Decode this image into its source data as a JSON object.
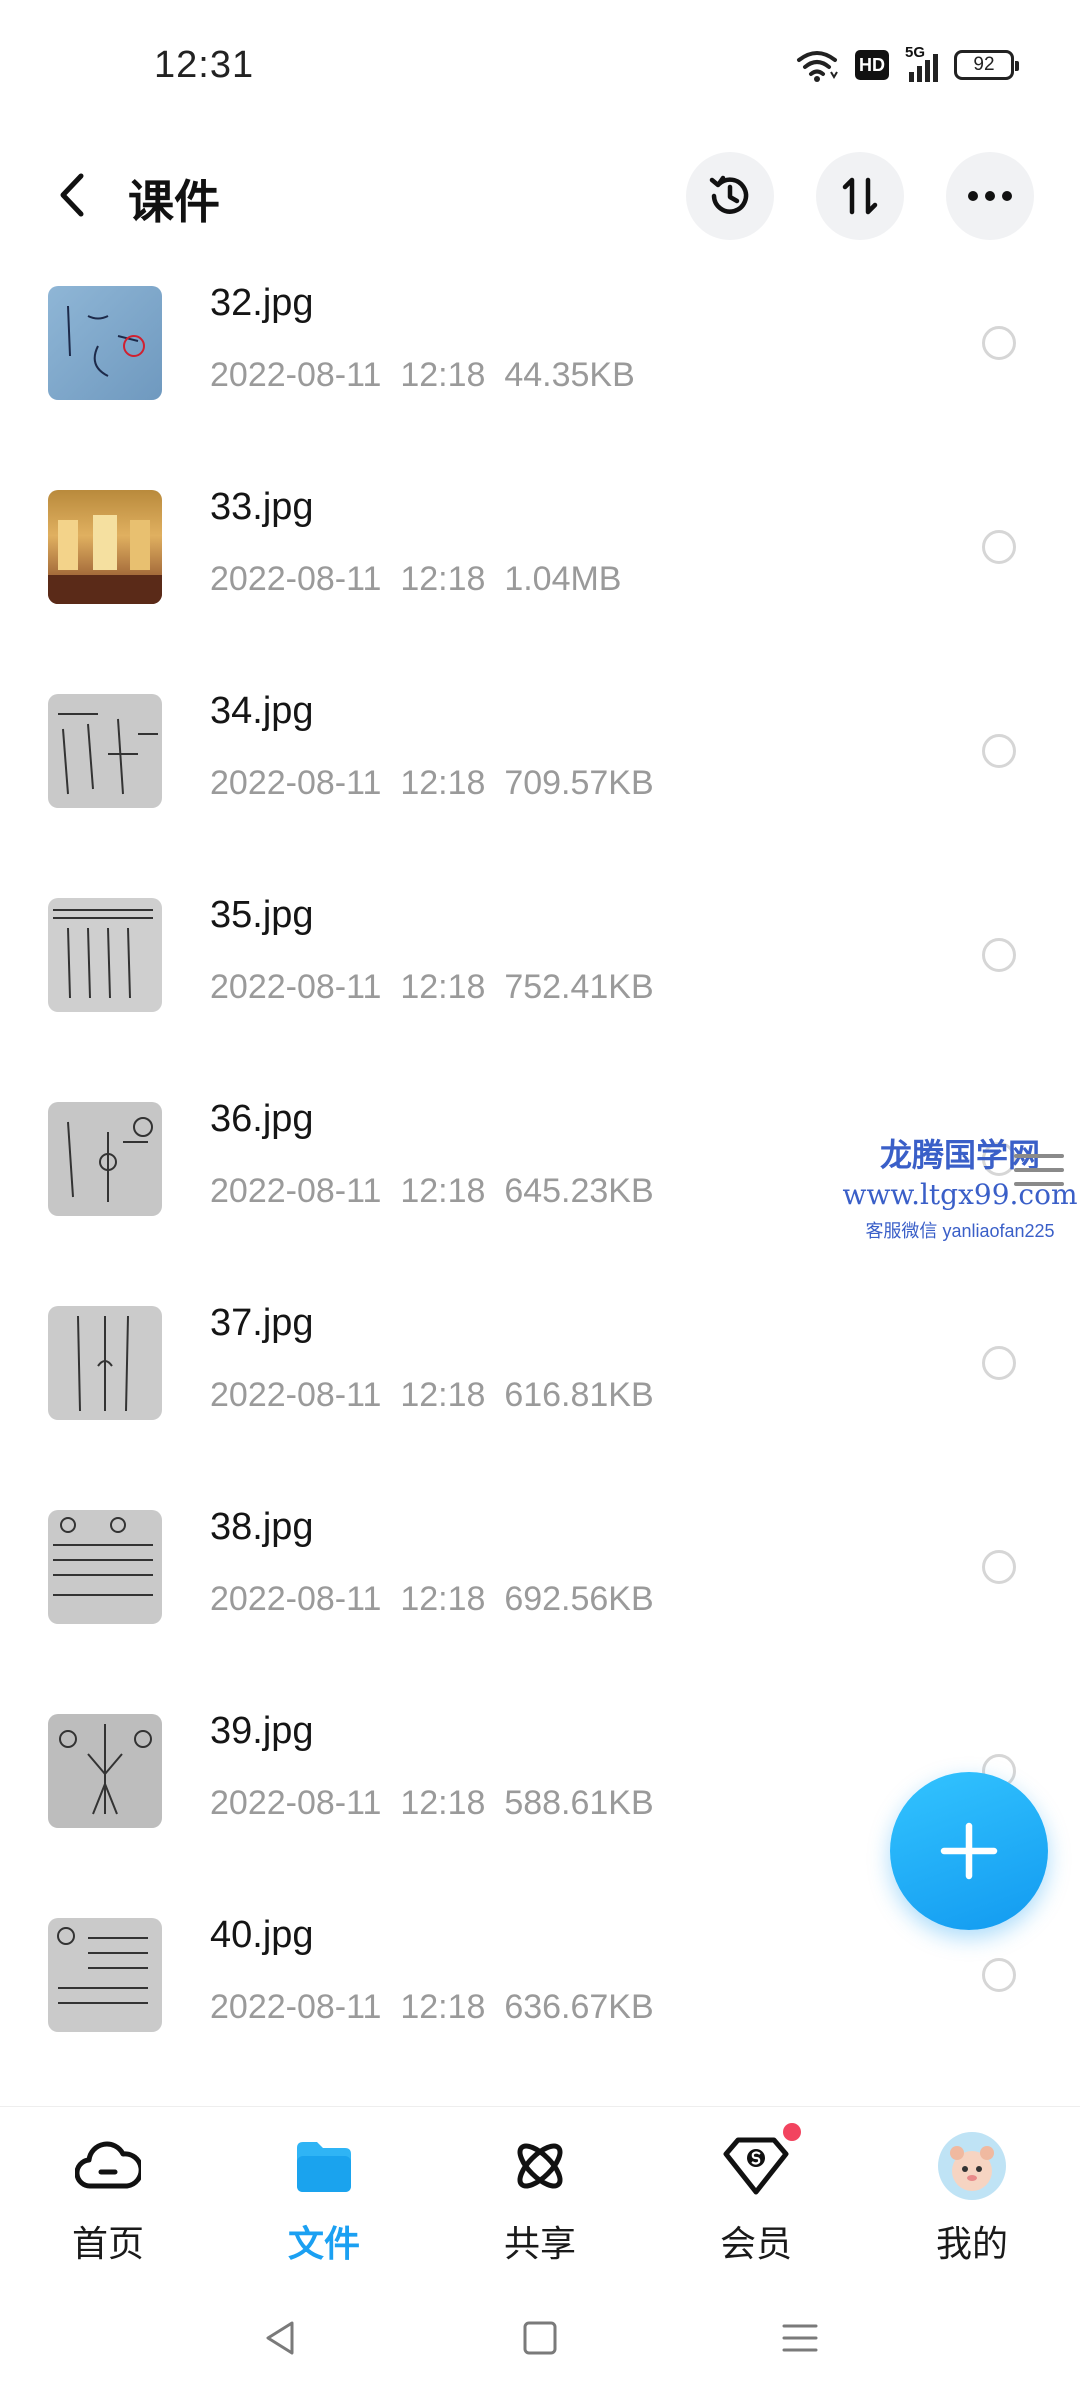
{
  "status_bar": {
    "time": "12:31",
    "network": "5G",
    "hd_label": "HD",
    "battery": "92"
  },
  "header": {
    "title": "课件",
    "back_icon": "chevron-left-icon",
    "actions": [
      "history-icon",
      "sort-icon",
      "more-icon"
    ]
  },
  "files": [
    {
      "name": "32.jpg",
      "date": "2022-08-11",
      "time": "12:18",
      "size": "44.35KB"
    },
    {
      "name": "33.jpg",
      "date": "2022-08-11",
      "time": "12:18",
      "size": "1.04MB"
    },
    {
      "name": "34.jpg",
      "date": "2022-08-11",
      "time": "12:18",
      "size": "709.57KB"
    },
    {
      "name": "35.jpg",
      "date": "2022-08-11",
      "time": "12:18",
      "size": "752.41KB"
    },
    {
      "name": "36.jpg",
      "date": "2022-08-11",
      "time": "12:18",
      "size": "645.23KB"
    },
    {
      "name": "37.jpg",
      "date": "2022-08-11",
      "time": "12:18",
      "size": "616.81KB"
    },
    {
      "name": "38.jpg",
      "date": "2022-08-11",
      "time": "12:18",
      "size": "692.56KB"
    },
    {
      "name": "39.jpg",
      "date": "2022-08-11",
      "time": "12:18",
      "size": "588.61KB"
    },
    {
      "name": "40.jpg",
      "date": "2022-08-11",
      "time": "12:18",
      "size": "636.67KB"
    }
  ],
  "watermark": {
    "line1": "龙腾国学网",
    "line2": "www.ltgx99.com",
    "line3": "客服微信 yanliaofan225"
  },
  "fab": {
    "icon": "plus-icon"
  },
  "bottom_nav": {
    "items": [
      {
        "label": "首页",
        "icon": "cloud-icon"
      },
      {
        "label": "文件",
        "icon": "folder-icon",
        "active": true
      },
      {
        "label": "共享",
        "icon": "atom-icon"
      },
      {
        "label": "会员",
        "icon": "vip-diamond-icon",
        "badge": true
      },
      {
        "label": "我的",
        "icon": "avatar"
      }
    ]
  },
  "colors": {
    "accent": "#1ba0f2",
    "meta_text": "#9a9a9a",
    "badge": "#f2445f"
  }
}
